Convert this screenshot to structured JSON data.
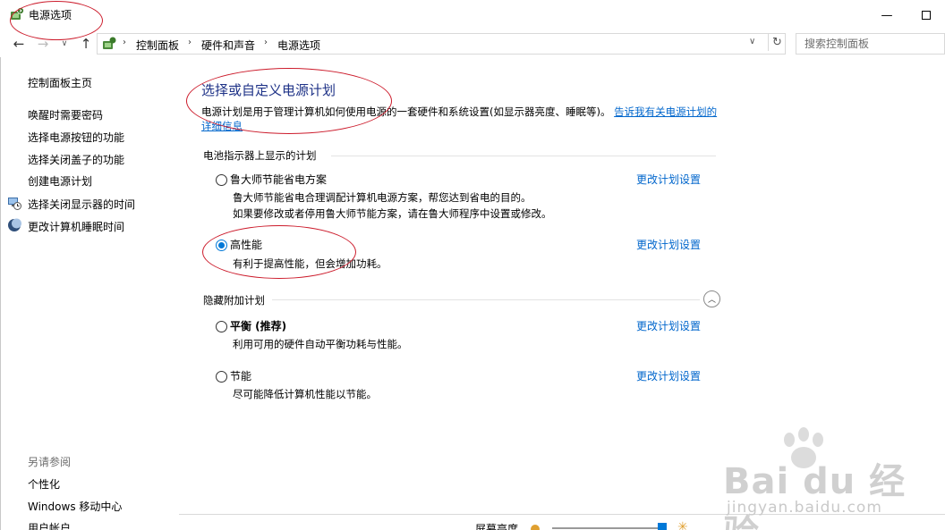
{
  "window": {
    "title": "电源选项",
    "minimize_glyph": "—"
  },
  "nav": {
    "back_glyph": "←",
    "forward_glyph": "→",
    "up_glyph": "↑",
    "dropdown_glyph": "∨",
    "breadcrumb": [
      "控制面板",
      "硬件和声音",
      "电源选项"
    ],
    "separator_glyph": "›",
    "refresh_glyph": "↻",
    "search_placeholder": "搜索控制面板"
  },
  "sidebar": {
    "home": "控制面板主页",
    "items": [
      {
        "label": "唤醒时需要密码",
        "icon": null
      },
      {
        "label": "选择电源按钮的功能",
        "icon": null
      },
      {
        "label": "选择关闭盖子的功能",
        "icon": null
      },
      {
        "label": "创建电源计划",
        "icon": null
      },
      {
        "label": "选择关闭显示器的时间",
        "icon": "display-clock-icon"
      },
      {
        "label": "更改计算机睡眠时间",
        "icon": "moon-icon"
      }
    ],
    "see_also_title": "另请参阅",
    "see_also": [
      "个性化",
      "Windows 移动中心",
      "用户帐户"
    ]
  },
  "main": {
    "heading": "选择或自定义电源计划",
    "description": "电源计划是用于管理计算机如何使用电源的一套硬件和系统设置(如显示器亮度、睡眠等)。",
    "description_link": "告诉我有关电源计划的详细信息",
    "battery_group_title": "电池指示器上显示的计划",
    "hidden_group_title": "隐藏附加计划",
    "change_link": "更改计划设置",
    "plans": [
      {
        "name": "鲁大师节能省电方案",
        "desc_lines": [
          "鲁大师节能省电合理调配计算机电源方案，帮您达到省电的目的。",
          "如果要修改或者停用鲁大师节能方案，请在鲁大师程序中设置或修改。"
        ],
        "selected": false
      },
      {
        "name": "高性能",
        "desc_lines": [
          "有利于提高性能，但会增加功耗。"
        ],
        "selected": true
      },
      {
        "name": "平衡 (推荐)",
        "desc_lines": [
          "利用可用的硬件自动平衡功耗与性能。"
        ],
        "selected": false
      },
      {
        "name": "节能",
        "desc_lines": [
          "尽可能降低计算机性能以节能。"
        ],
        "selected": false
      }
    ],
    "collapse_glyph": "︿"
  },
  "footer": {
    "brightness_label": "屏幕亮度",
    "brightness_level_percent": 95,
    "sun_glyph": "✳"
  },
  "watermark": {
    "brand": "Bai du 经验",
    "url": "jingyan.baidu.com"
  },
  "colors": {
    "heading": "#1e3287",
    "link": "#0066cc",
    "radio_selected": "#0078d7",
    "annotation": "#cc1b2b",
    "watermark": "#c9c9c9"
  }
}
